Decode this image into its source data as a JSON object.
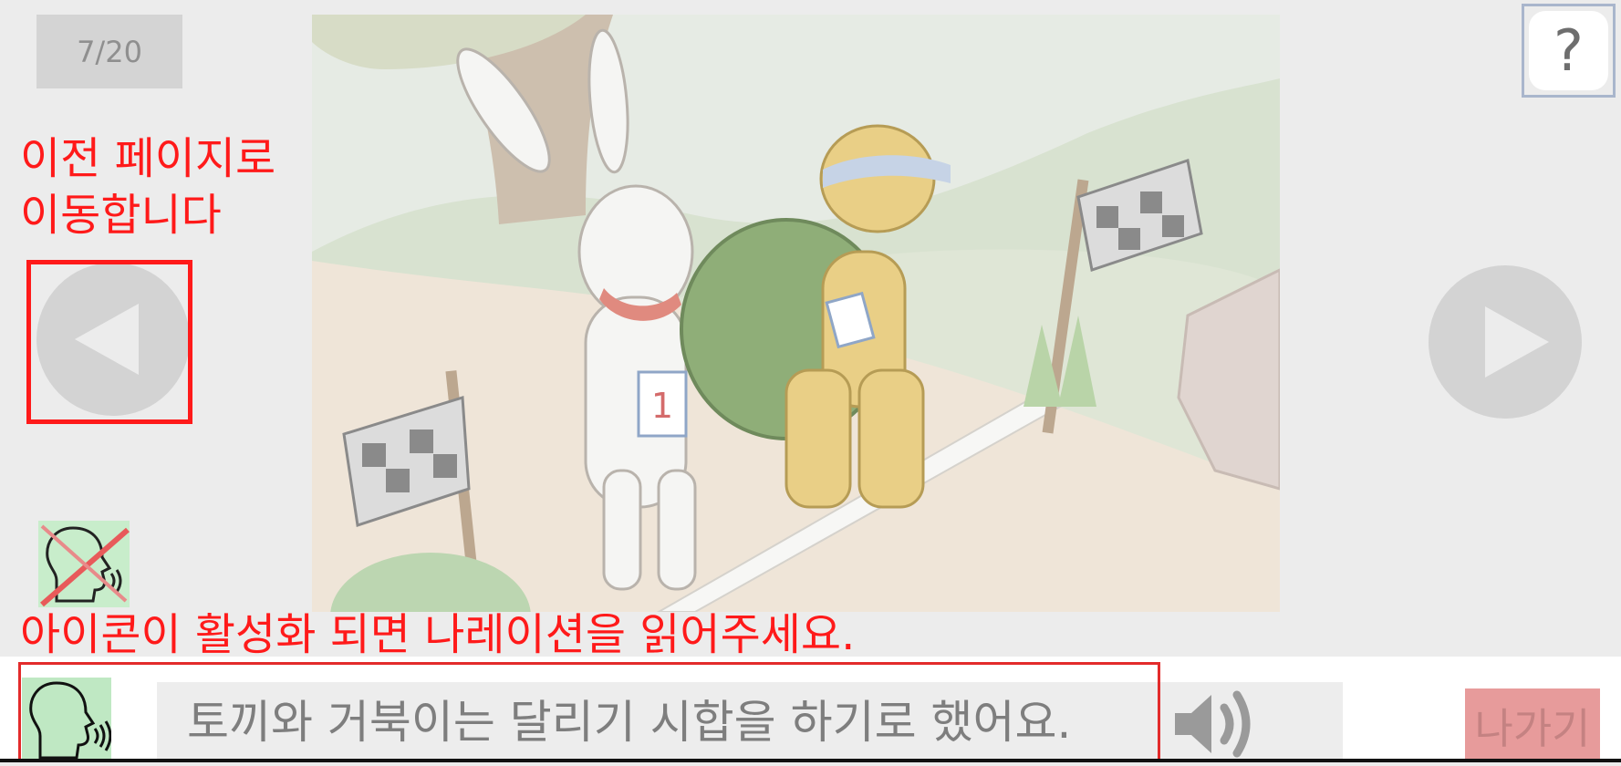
{
  "page_counter": "7/20",
  "help": {
    "label": "?"
  },
  "annotations": {
    "prev_hint": "이전 페이지로\n이동합니다",
    "narration_hint": "아이콘이 활성화 되면 나레이션을 읽어주세요."
  },
  "narration": {
    "text": "토끼와 거북이는 달리기 시합을 하기로 했어요."
  },
  "exit": {
    "label": "나가기"
  },
  "colors": {
    "annotation_red": "#ff1a1a",
    "nav_gray": "#d3d3d3",
    "narration_green": "#bfe8c3",
    "exit_bg": "#e79b9b"
  }
}
